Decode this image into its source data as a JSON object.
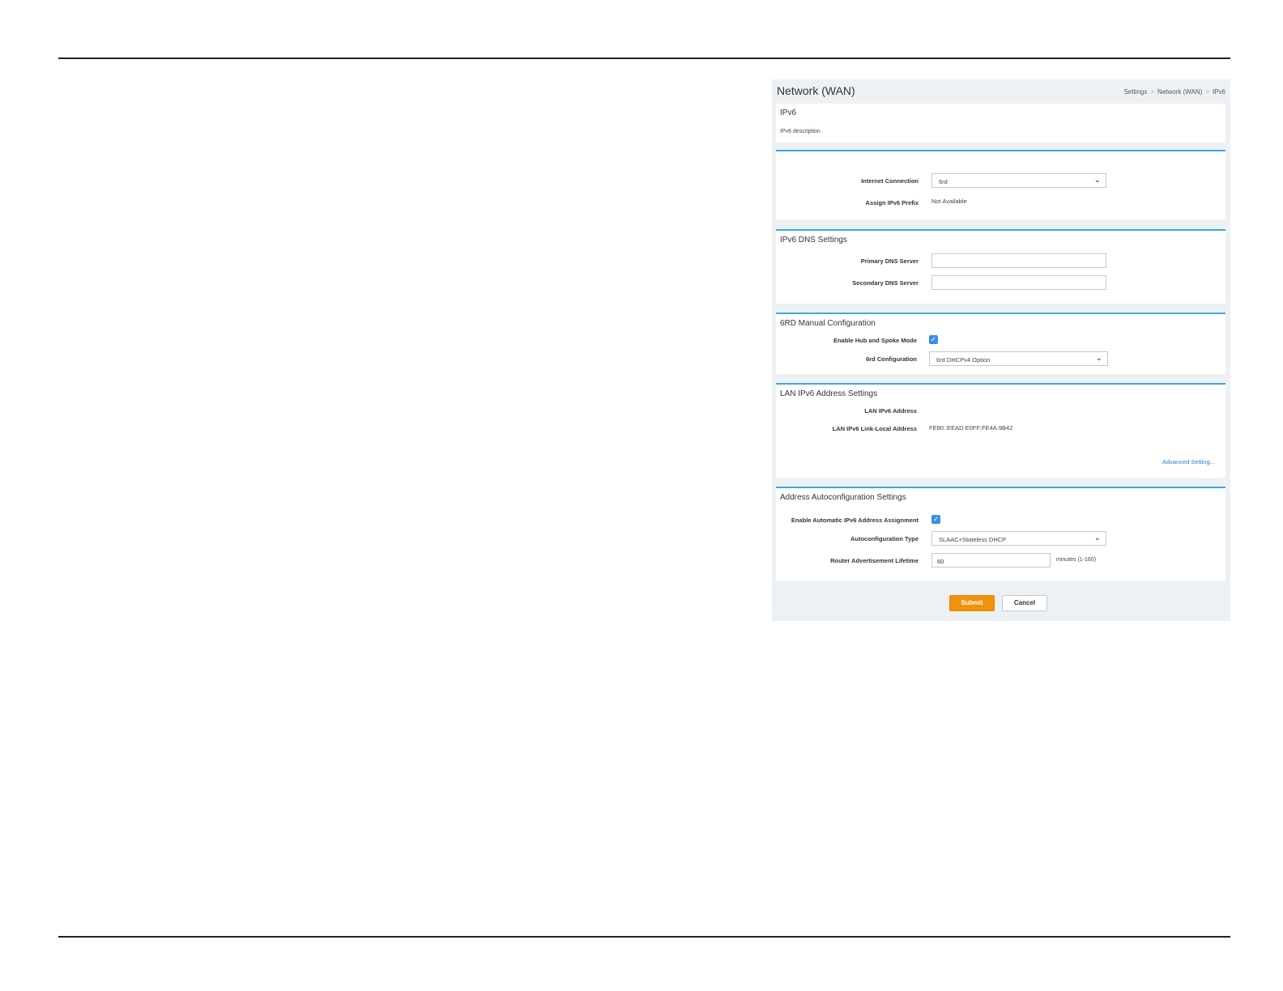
{
  "header": {
    "title": "Network (WAN)",
    "breadcrumb": [
      "Settings",
      "Network (WAN)",
      "IPv6"
    ],
    "breadcrumb_sep": ">"
  },
  "ipv6": {
    "title": "IPv6",
    "description": "IPv6 description"
  },
  "connection": {
    "internet_connection_label": "Internet Connection",
    "internet_connection_value": "6rd",
    "assign_prefix_label": "Assign IPv6 Prefix",
    "assign_prefix_value": "Not Available"
  },
  "dns": {
    "title": "IPv6 DNS Settings",
    "primary_label": "Primary DNS Server",
    "primary_value": "",
    "secondary_label": "Secondary DNS Server",
    "secondary_value": ""
  },
  "sixrd": {
    "title": "6RD Manual Configuration",
    "hub_spoke_label": "Enable Hub and Spoke Mode",
    "hub_spoke_checked": true,
    "config_label": "6rd Configuration",
    "config_value": "6rd DHCPv4 Option"
  },
  "lan": {
    "title": "LAN IPv6 Address Settings",
    "address_label": "LAN IPv6 Address",
    "address_value": "",
    "link_local_label": "LAN IPv6 Link-Local Address",
    "link_local_value": "FE80::EEAD:E0FF:FE4A:9B42",
    "advanced_link": "Advanced Setting..."
  },
  "autoconfig": {
    "title": "Address Autoconfiguration Settings",
    "enable_label": "Enable Automatic IPv6 Address Assignment",
    "enable_checked": true,
    "type_label": "Autoconfiguration Type",
    "type_value": "SLAAC+Stateless DHCP",
    "lifetime_label": "Router Advertisement Lifetime",
    "lifetime_value": "60",
    "lifetime_unit": "minutes (1-160)"
  },
  "actions": {
    "submit": "Submit",
    "cancel": "Cancel"
  },
  "colors": {
    "accent": "#3fa9dd",
    "submit": "#f0920c",
    "checkbox": "#3a8ee6"
  },
  "icons": {
    "select": "chevron-down-icon",
    "checkbox": "checkmark-icon"
  }
}
